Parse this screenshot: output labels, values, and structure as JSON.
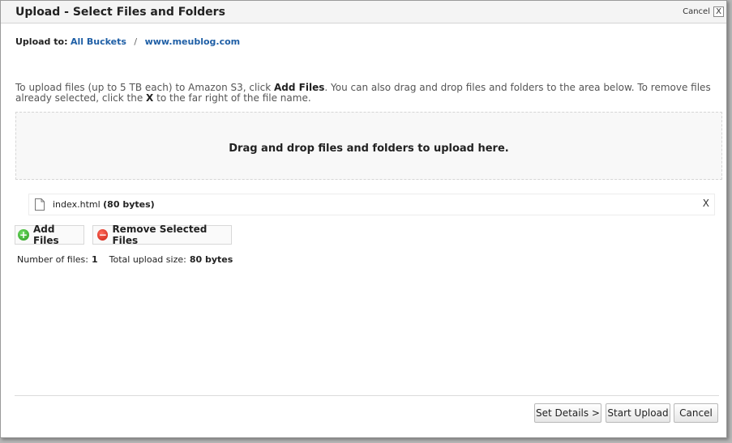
{
  "dialog": {
    "title": "Upload - Select Files and Folders",
    "cancel_label": "Cancel",
    "close_glyph": "X"
  },
  "upload_to": {
    "label": "Upload to:",
    "breadcrumb": [
      "All Buckets",
      "www.meublog.com"
    ],
    "separator": "/"
  },
  "instructions": {
    "part1": "To upload files (up to 5 TB each) to Amazon S3, click ",
    "bold1": "Add Files",
    "part2": ". You can also drag and drop files and folders to the area below. To remove files already selected, click the ",
    "bold2": "X",
    "part3": " to the far right of the file name."
  },
  "dropzone": {
    "message": "Drag and drop files and folders to upload here."
  },
  "files": [
    {
      "name": "index.html",
      "size": "(80 bytes)",
      "icon": "file-icon",
      "remove_glyph": "X"
    }
  ],
  "actions": {
    "add_files": "Add Files",
    "remove_selected": "Remove Selected Files"
  },
  "stats": {
    "count_label": "Number of files:",
    "count_value": "1",
    "size_label": "Total upload size:",
    "size_value": "80 bytes"
  },
  "footer": {
    "set_details": "Set Details >",
    "start_upload": "Start Upload",
    "cancel": "Cancel"
  },
  "colors": {
    "link": "#1f5fa6",
    "add_icon": "#2a9a1f",
    "remove_icon": "#c91f12"
  }
}
